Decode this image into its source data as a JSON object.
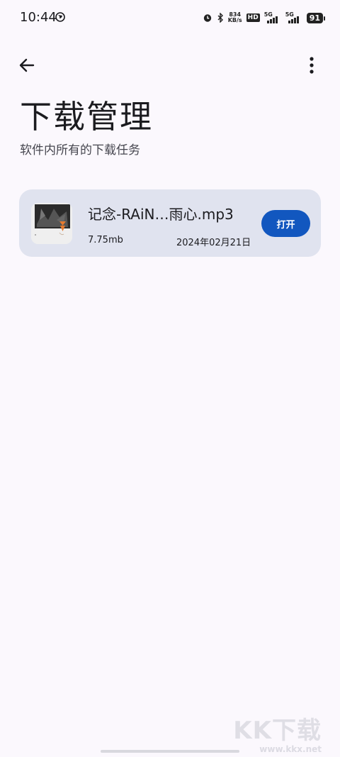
{
  "status_bar": {
    "time": "10:44",
    "speed_value": "834",
    "speed_unit": "KB/s",
    "hd_label": "HD",
    "network_1": "5G",
    "network_2": "5G",
    "battery": "91"
  },
  "header": {
    "back_icon": "arrow-left-icon",
    "more_icon": "more-vertical-icon",
    "title": "下载管理",
    "subtitle": "软件内所有的下载任务"
  },
  "downloads": [
    {
      "name": "记念-RAiN…雨心.mp3",
      "size": "7.75mb",
      "date": "2024年02月21日",
      "action_label": "打开"
    }
  ],
  "watermark": {
    "logo": "KK下载",
    "url": "www.kkx.net"
  },
  "colors": {
    "background": "#fbf8fd",
    "card": "#e0e3ef",
    "accent": "#1257bf"
  }
}
